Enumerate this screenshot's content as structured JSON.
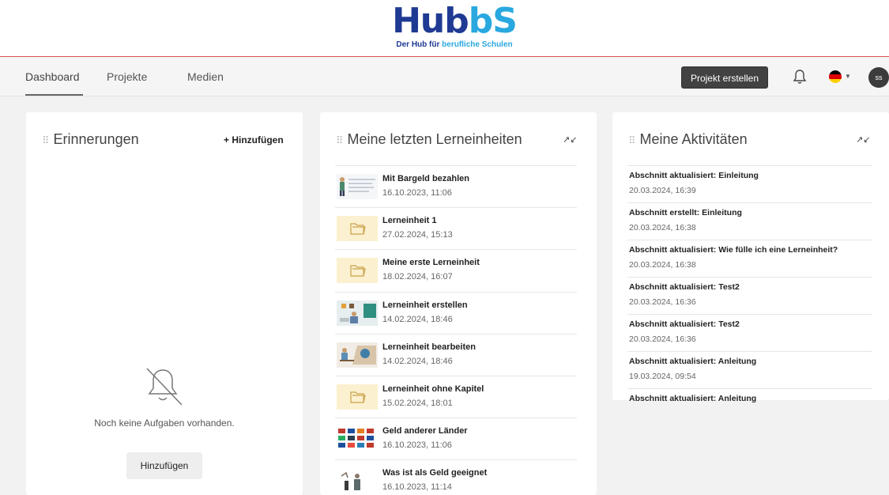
{
  "header": {
    "logo_word_hub": "Hub",
    "logo_word_bs": "bS",
    "logo_sub_pre": "Der Hub für ",
    "logo_sub_accent": "berufliche Schulen"
  },
  "nav": {
    "tabs": [
      {
        "label": "Dashboard",
        "active": true
      },
      {
        "label": "Projekte",
        "active": false
      },
      {
        "label": "Medien",
        "active": false
      }
    ],
    "create_button": "Projekt erstellen",
    "language": "de",
    "avatar_initials": "ss"
  },
  "reminders": {
    "title": "Erinnerungen",
    "add_link": "+ Hinzufügen",
    "empty_text": "Noch keine Aufgaben vorhanden.",
    "empty_button": "Hinzufügen"
  },
  "learning_units": {
    "title": "Meine letzten Lerneinheiten",
    "items": [
      {
        "title": "Mit Bargeld bezahlen",
        "date": "16.10.2023, 11:06",
        "thumb": "person-text-thumb"
      },
      {
        "title": "Lerneinheit 1",
        "date": "27.02.2024, 15:13",
        "thumb": "folder-thumb"
      },
      {
        "title": "Meine erste Lerneinheit",
        "date": "18.02.2024, 16:07",
        "thumb": "folder-thumb"
      },
      {
        "title": "Lerneinheit erstellen",
        "date": "14.02.2024, 18:46",
        "thumb": "classroom-thumb"
      },
      {
        "title": "Lerneinheit bearbeiten",
        "date": "14.02.2024, 18:46",
        "thumb": "desk-thumb"
      },
      {
        "title": "Lerneinheit ohne Kapitel",
        "date": "15.02.2024, 18:01",
        "thumb": "folder-thumb"
      },
      {
        "title": "Geld anderer Länder",
        "date": "16.10.2023, 11:06",
        "thumb": "flags-thumb"
      },
      {
        "title": "Was ist als Geld geeignet",
        "date": "16.10.2023, 11:14",
        "thumb": "figures-thumb"
      }
    ]
  },
  "activities": {
    "title": "Meine Aktivitäten",
    "items": [
      {
        "title": "Abschnitt aktualisiert: Einleitung",
        "date": "20.03.2024, 16:39"
      },
      {
        "title": "Abschnitt erstellt: Einleitung",
        "date": "20.03.2024, 16:38"
      },
      {
        "title": "Abschnitt aktualisiert: Wie fülle ich eine Lerneinheit?",
        "date": "20.03.2024, 16:38"
      },
      {
        "title": "Abschnitt aktualisiert: Test2",
        "date": "20.03.2024, 16:36"
      },
      {
        "title": "Abschnitt aktualisiert: Test2",
        "date": "20.03.2024, 16:36"
      },
      {
        "title": "Abschnitt aktualisiert: Anleitung",
        "date": "19.03.2024, 09:54"
      },
      {
        "title": "Abschnitt aktualisiert: Anleitung",
        "date": ""
      }
    ]
  },
  "colors": {
    "accent_red": "#d9534f",
    "logo_dark_blue": "#1f3a93",
    "logo_light_blue": "#29a8e0",
    "button_dark": "#424242"
  }
}
